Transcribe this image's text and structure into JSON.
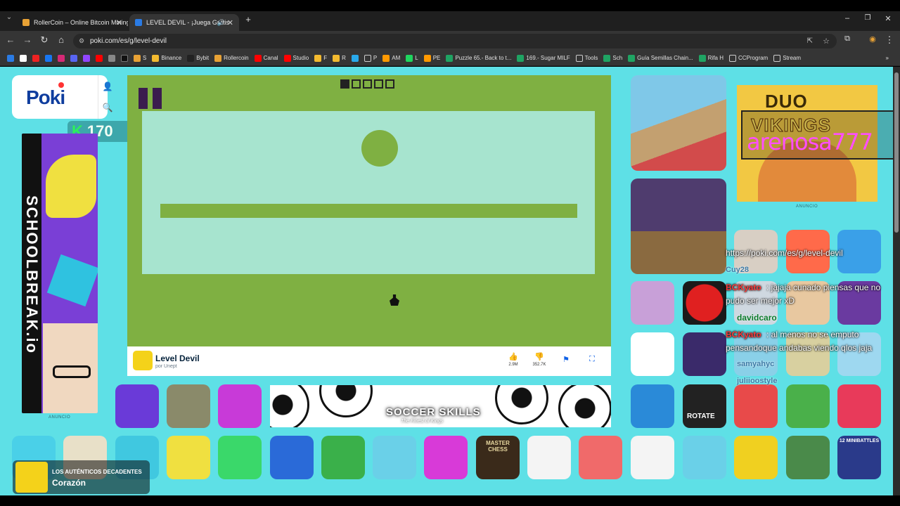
{
  "browser": {
    "tabs": [
      {
        "title": "RollerCoin – Online Bitcoin Mining",
        "active": false
      },
      {
        "title": "LEVEL DEVIL - ¡Juega Gratis",
        "active": true
      }
    ],
    "new_tab_icon": "plus-icon",
    "url": "poki.com/es/g/level-devil",
    "bookmarks": [
      "S",
      "Binance",
      "Bybit",
      "Rollercoin",
      "Canal",
      "Studio",
      "F",
      "R",
      "P",
      "AM",
      "L",
      "PE",
      "Puzzle 65.- Back to t...",
      "169.- Sugar MILF",
      "Tools",
      "Sch",
      "Guía Semillas Chain...",
      "Rifa H",
      "CCProgram",
      "Stream"
    ]
  },
  "poki": {
    "logo": "Poki",
    "coins": "170",
    "ad_label": "ANUNCIO",
    "left_ad_text": "SCHOOLBREAK.io",
    "right_ad_title_1": "DUO",
    "right_ad_title_2": "VIKINGS"
  },
  "game": {
    "name": "Level Devil",
    "author": "por Unept",
    "likes": "2.9M",
    "dislikes": "352.7K",
    "progress_total": 5,
    "progress_completed": 1
  },
  "banner": {
    "title": "SOCCER SKILLS",
    "subtitle": "The Finest of Kings",
    "ad_label": "ANUNCIO"
  },
  "tiles": {
    "rotate_label": "ROTATE",
    "chess_label": "MASTER CHESS",
    "minibattles_label": "12 MINIBATTLES"
  },
  "stream_overlay": {
    "streamer": "arenosa777",
    "url_text": "https://poki.com/es/g/level-devil",
    "chat": [
      {
        "user": "Cuy28",
        "text": ""
      },
      {
        "user": "BCKyato",
        "text": ": jajaja cunado piensas que no"
      },
      {
        "user": "",
        "text": "pudo ser mejor xD"
      },
      {
        "user": "davidcaro",
        "text": ""
      },
      {
        "user": "BCKyato",
        "text": ": al menos no se emputo"
      },
      {
        "user": "",
        "text": "pensandoque andabas viendo qlos jaja"
      },
      {
        "user": "samyahyc",
        "text": ""
      },
      {
        "user": "juliioostyle",
        "text": ""
      }
    ]
  },
  "music": {
    "artist": "LOS AUTÉNTICOS DECADENTES",
    "song": "Corazón"
  },
  "colors": {
    "page_bg": "#5ee0e6",
    "game_green": "#7fb042",
    "arena_mint": "#a7e4cf",
    "poki_blue": "#0f3d9e"
  }
}
